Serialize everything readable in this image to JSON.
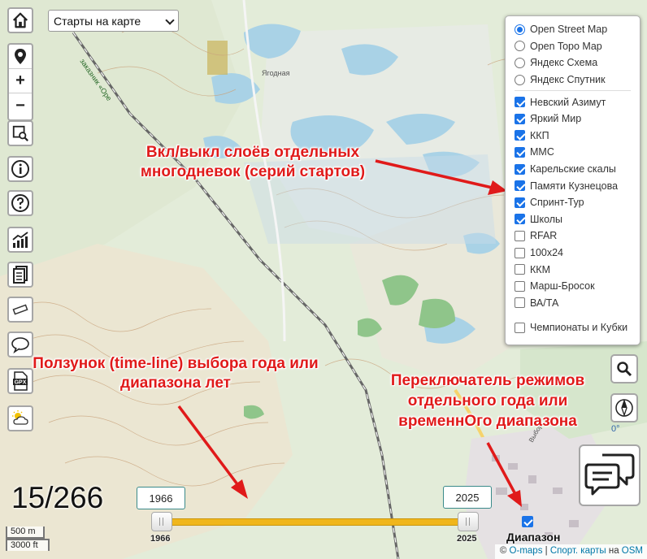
{
  "app": {
    "mode_select": {
      "value": "Старты на карте"
    }
  },
  "basemaps": [
    {
      "label": "Open Street Map",
      "selected": true
    },
    {
      "label": "Open Topo Map",
      "selected": false
    },
    {
      "label": "Яндекс Схема",
      "selected": false
    },
    {
      "label": "Яндекс Спутник",
      "selected": false
    }
  ],
  "overlays": [
    {
      "label": "Невский Азимут",
      "checked": true
    },
    {
      "label": "Яркий Мир",
      "checked": true
    },
    {
      "label": "ККП",
      "checked": true
    },
    {
      "label": "ММС",
      "checked": true
    },
    {
      "label": "Карельские скалы",
      "checked": true
    },
    {
      "label": "Памяти Кузнецова",
      "checked": true
    },
    {
      "label": "Спринт-Тур",
      "checked": true
    },
    {
      "label": "Школы",
      "checked": true
    },
    {
      "label": "RFAR",
      "checked": false
    },
    {
      "label": "100x24",
      "checked": false
    },
    {
      "label": "ККМ",
      "checked": false
    },
    {
      "label": "Марш-Бросок",
      "checked": false
    },
    {
      "label": "ВА/ТА",
      "checked": false
    }
  ],
  "championships": {
    "label": "Чемпионаты и Кубки",
    "checked": false
  },
  "annotations": {
    "layers": "Вкл/выкл слоёв отдельных многодневок (серий стартов)",
    "slider": "Ползунок (time-line) выбора года или диапазона лет",
    "toggle": "Переключатель режимов отдельного года или временнОго диапазона"
  },
  "counter": "15/266",
  "timeline": {
    "from_year": "1966",
    "to_year": "2025",
    "min_label": "1966",
    "max_label": "2025",
    "range_label": "Диапазон",
    "range_checked": true
  },
  "compass": {
    "label": "0°"
  },
  "scale": {
    "metric": "500 m",
    "imperial": "3000 ft"
  },
  "attribution": {
    "prefix": "© ",
    "omaps": "O-maps",
    "sep": " | ",
    "sport": "Спорт. карты",
    "mid": " на ",
    "osm": "OSM"
  },
  "map_labels": {
    "label1": "Ягодная",
    "label2": "заказник «Оре",
    "label3": "Выборг"
  },
  "colors": {
    "accent": "#1a73e8",
    "annotation": "#e01a1a",
    "track": "#f0b61c"
  }
}
